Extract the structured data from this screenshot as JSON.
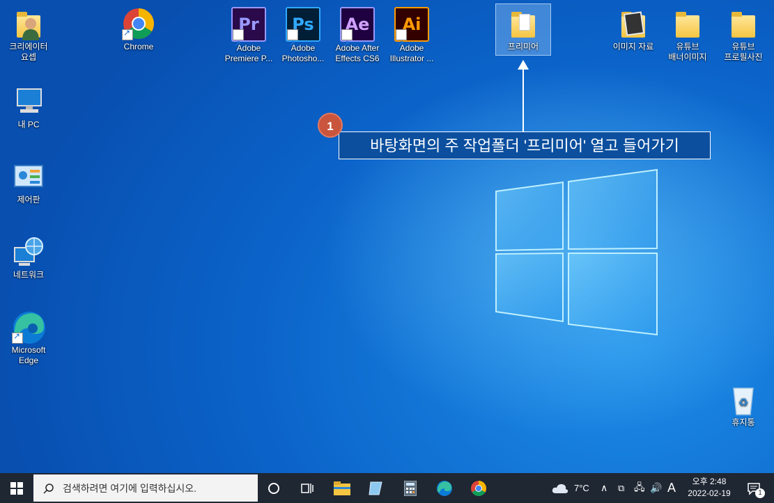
{
  "desktop": {
    "icons": [
      {
        "label": "크리에이터\n요셉"
      },
      {
        "label": "Chrome"
      },
      {
        "label": "Adobe\nPremiere P..."
      },
      {
        "label": "Adobe\nPhotosho..."
      },
      {
        "label": "Adobe After\nEffects CS6"
      },
      {
        "label": "Adobe\nIllustrator ..."
      },
      {
        "label": "프리미어"
      },
      {
        "label": "이미지 자료"
      },
      {
        "label": "유튜브\n배너이미지"
      },
      {
        "label": "유튜브\n프로필사진"
      },
      {
        "label": "내 PC"
      },
      {
        "label": "제어판"
      },
      {
        "label": "네트워크"
      },
      {
        "label": "Microsoft\nEdge"
      },
      {
        "label": "휴지통"
      }
    ],
    "adobe_glyphs": {
      "pr": "Pr",
      "ps": "Ps",
      "ae": "Ae",
      "ai": "Ai"
    }
  },
  "callout": {
    "number": "1",
    "text": "바탕화면의 주 작업폴더 '프리미어' 열고 들어가기"
  },
  "taskbar": {
    "search_placeholder": "검색하려면 여기에 입력하십시오.",
    "weather": "7°C",
    "ime": "A",
    "time": "오후 2:48",
    "date": "2022-02-19",
    "notification_count": "1"
  },
  "colors": {
    "premiere": "#9999ff",
    "photoshop": "#31a8ff",
    "after_effects": "#9999ff",
    "illustrator": "#ff9a00",
    "callout_badge": "#c9553d"
  }
}
